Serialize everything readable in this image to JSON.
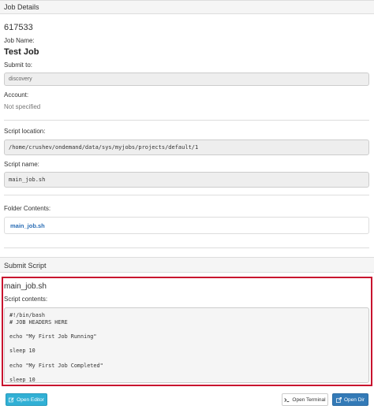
{
  "job_details": {
    "heading": "Job Details",
    "job_id": "617533",
    "job_name_label": "Job Name:",
    "job_name": "Test Job",
    "submit_to_label": "Submit to:",
    "submit_to": "discovery",
    "account_label": "Account:",
    "account": "Not specified",
    "script_location_label": "Script location:",
    "script_location": "/home/crushev/ondemand/data/sys/myjobs/projects/default/1",
    "script_name_label": "Script name:",
    "script_name": "main_job.sh",
    "folder_contents_label": "Folder Contents:",
    "folder_contents": [
      "main_job.sh"
    ]
  },
  "submit_script": {
    "heading": "Submit Script",
    "filename": "main_job.sh",
    "contents_label": "Script contents:",
    "contents": "#!/bin/bash\n# JOB HEADERS HERE\n\necho \"My First Job Running\"\n\nsleep 10\n\necho \"My First Job Completed\"\n\nsleep 10"
  },
  "buttons": {
    "open_editor": "Open Editor",
    "open_terminal": "Open Terminal",
    "open_dir": "Open Dir"
  },
  "colors": {
    "highlight_border": "#c8102e",
    "link": "#2a6db5",
    "info_button": "#31b0d5",
    "primary_button": "#337ab7"
  },
  "icons": {
    "editor": "edit-icon",
    "terminal": "terminal-icon",
    "dir": "external-link-icon"
  }
}
